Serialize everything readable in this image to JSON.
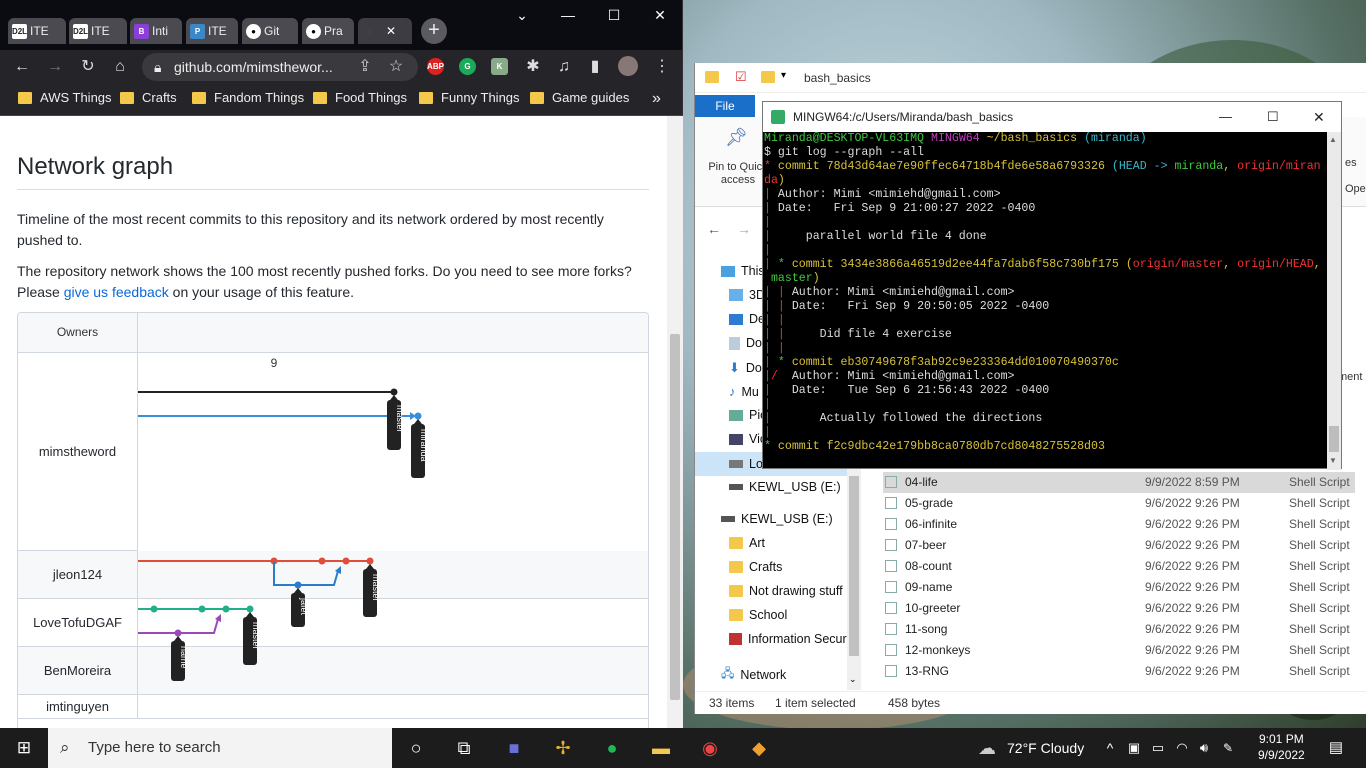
{
  "browser": {
    "tabs": [
      {
        "label": "ITE",
        "favicon": "D2L"
      },
      {
        "label": "ITE",
        "favicon": "D2L"
      },
      {
        "label": "Inti",
        "favicon": "B"
      },
      {
        "label": "ITE",
        "favicon": "P"
      },
      {
        "label": "Git",
        "favicon": "gh"
      },
      {
        "label": "Pra",
        "favicon": "gh"
      }
    ],
    "url": "github.com/mimsthewor...",
    "bookmarks": [
      "AWS Things",
      "Crafts",
      "Fandom Things",
      "Food Things",
      "Funny Things",
      "Game guides"
    ],
    "extensions": [
      "ABP",
      "G",
      "K"
    ],
    "ext_colors": [
      "#d22",
      "#1ca95a",
      "#8a8"
    ]
  },
  "github": {
    "heading": "Network graph",
    "para1": "Timeline of the most recent commits to this repository and its network ordered by most recently pushed to.",
    "para2_prefix": "The repository network shows the 100 most recently pushed forks. Do you need to see more forks? Please ",
    "para2_link": "give us feedback",
    "para2_suffix": " on your usage of this feature.",
    "owners_header": "Owners",
    "owners": [
      "mimstheword",
      "jleon124",
      "LoveTofuDGAF",
      "BenMoreira",
      "imtinguyen"
    ],
    "date_label": "9",
    "branch_labels": [
      "master",
      "miranda",
      "jafet",
      "master",
      "name",
      "master"
    ]
  },
  "explorer": {
    "path": "bash_basics",
    "file_tab": "File",
    "ribbon_pin": "Pin to Quick access",
    "nav": [
      "This",
      "3D",
      "De",
      "Do",
      "Do",
      "Mu",
      "Pic",
      "Vic",
      "Lo",
      "KEWL_USB (E:)",
      "KEWL_USB (E:)",
      "Art",
      "Crafts",
      "Not drawing stuff",
      "School",
      "Information Securi",
      "Network"
    ],
    "files": [
      {
        "name": "04-life",
        "date": "9/9/2022 8:59 PM",
        "type": "Shell Script"
      },
      {
        "name": "05-grade",
        "date": "9/6/2022 9:26 PM",
        "type": "Shell Script"
      },
      {
        "name": "06-infinite",
        "date": "9/6/2022 9:26 PM",
        "type": "Shell Script"
      },
      {
        "name": "07-beer",
        "date": "9/6/2022 9:26 PM",
        "type": "Shell Script"
      },
      {
        "name": "08-count",
        "date": "9/6/2022 9:26 PM",
        "type": "Shell Script"
      },
      {
        "name": "09-name",
        "date": "9/6/2022 9:26 PM",
        "type": "Shell Script"
      },
      {
        "name": "10-greeter",
        "date": "9/6/2022 9:26 PM",
        "type": "Shell Script"
      },
      {
        "name": "11-song",
        "date": "9/6/2022 9:26 PM",
        "type": "Shell Script"
      },
      {
        "name": "12-monkeys",
        "date": "9/6/2022 9:26 PM",
        "type": "Shell Script"
      },
      {
        "name": "13-RNG",
        "date": "9/6/2022 9:26 PM",
        "type": "Shell Script"
      }
    ],
    "status_items": "33 items",
    "status_selected": "1 item selected",
    "status_size": "458 bytes",
    "right_edge": [
      "es",
      "Ope",
      "ment"
    ]
  },
  "terminal": {
    "title": "MINGW64:/c/Users/Miranda/bash_basics",
    "lines": [
      {
        "segs": [
          [
            "Miranda@DESKTOP-VL63IMQ ",
            "#3ec93e"
          ],
          [
            "MINGW64 ",
            "#c43ec4"
          ],
          [
            "~/bash_basics ",
            "#d8c23a"
          ],
          [
            "(miranda)",
            "#3ab8c8"
          ]
        ]
      },
      {
        "segs": [
          [
            "$ git log --graph --all",
            "#ddd"
          ]
        ]
      },
      {
        "segs": [
          [
            "* ",
            "#e33"
          ],
          [
            "commit 78d43d64ae7e90ffec64718b4fde6e58a6793326 ",
            "#d8c23a"
          ],
          [
            "(HEAD -> ",
            "#3ab8c8"
          ],
          [
            "miranda",
            "#3ec93e"
          ],
          [
            ", ",
            "#d8c23a"
          ],
          [
            "origin/miran",
            "#e33"
          ]
        ]
      },
      {
        "segs": [
          [
            "da",
            "#e33"
          ],
          [
            ")",
            "#d8c23a"
          ]
        ]
      },
      {
        "segs": [
          [
            "| ",
            "#e33"
          ],
          [
            "Author: Mimi <mimiehd@gmail.com>",
            "#ddd"
          ]
        ]
      },
      {
        "segs": [
          [
            "| ",
            "#e33"
          ],
          [
            "Date:   Fri Sep 9 21:00:27 2022 -0400",
            "#ddd"
          ]
        ]
      },
      {
        "segs": [
          [
            "|",
            "#e33"
          ]
        ]
      },
      {
        "segs": [
          [
            "|     ",
            "#e33"
          ],
          [
            "parallel world file 4 done",
            "#ddd"
          ]
        ]
      },
      {
        "segs": [
          [
            "|",
            "#e33"
          ]
        ]
      },
      {
        "segs": [
          [
            "| ",
            "#e33"
          ],
          [
            "* ",
            "#3ec93e"
          ],
          [
            "commit 3434e3866a46519d2ee44fa7dab6f58c730bf175 ",
            "#d8c23a"
          ],
          [
            "(",
            "#d8c23a"
          ],
          [
            "origin/master",
            "#e33"
          ],
          [
            ", ",
            "#d8c23a"
          ],
          [
            "origin/HEAD",
            "#e33"
          ],
          [
            ",",
            "#d8c23a"
          ]
        ]
      },
      {
        "segs": [
          [
            " master",
            "#3ec93e"
          ],
          [
            ")",
            "#d8c23a"
          ]
        ]
      },
      {
        "segs": [
          [
            "| | ",
            "#e33"
          ],
          [
            "Author: Mimi <mimiehd@gmail.com>",
            "#ddd"
          ]
        ]
      },
      {
        "segs": [
          [
            "| | ",
            "#e33"
          ],
          [
            "Date:   Fri Sep 9 20:50:05 2022 -0400",
            "#ddd"
          ]
        ]
      },
      {
        "segs": [
          [
            "| |",
            "#e33"
          ]
        ]
      },
      {
        "segs": [
          [
            "| |     ",
            "#e33"
          ],
          [
            "Did file 4 exercise",
            "#ddd"
          ]
        ]
      },
      {
        "segs": [
          [
            "| |",
            "#e33"
          ]
        ]
      },
      {
        "segs": [
          [
            "| ",
            "#e33"
          ],
          [
            "* ",
            "#3ec93e"
          ],
          [
            "commit eb30749678f3ab92c9e233364dd010070490370c",
            "#d8c23a"
          ]
        ]
      },
      {
        "segs": [
          [
            "|/  ",
            "#e33"
          ],
          [
            "Author: Mimi <mimiehd@gmail.com>",
            "#ddd"
          ]
        ]
      },
      {
        "segs": [
          [
            "|   ",
            "#e33"
          ],
          [
            "Date:   Tue Sep 6 21:56:43 2022 -0400",
            "#ddd"
          ]
        ]
      },
      {
        "segs": [
          [
            "|",
            "#e33"
          ]
        ]
      },
      {
        "segs": [
          [
            "|       ",
            "#e33"
          ],
          [
            "Actually followed the directions",
            "#ddd"
          ]
        ]
      },
      {
        "segs": [
          [
            "|",
            "#e33"
          ]
        ]
      },
      {
        "segs": [
          [
            "* ",
            "#3ec93e"
          ],
          [
            "commit f2c9dbc42e179bb8ca0780db7cd8048275528d03",
            "#d8c23a"
          ]
        ]
      }
    ]
  },
  "taskbar": {
    "search_placeholder": "Type here to search",
    "weather": "72°F  Cloudy",
    "time": "9:01 PM",
    "date": "9/9/2022"
  }
}
